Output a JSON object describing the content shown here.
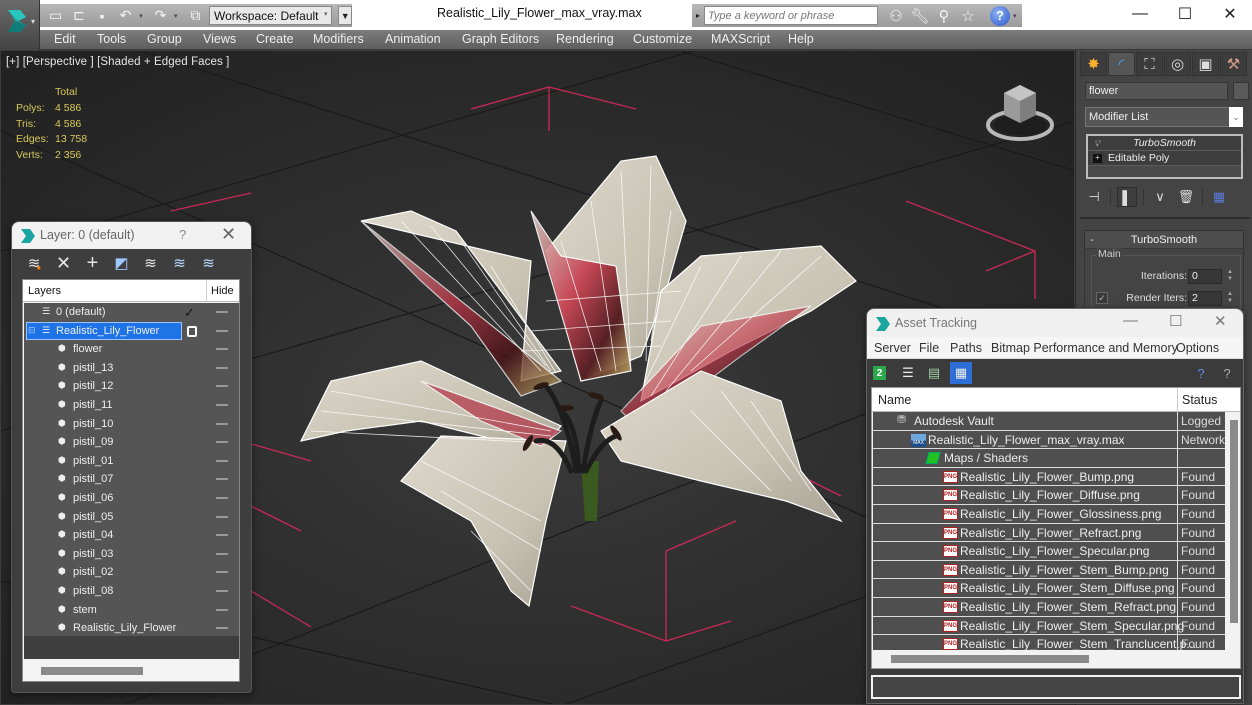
{
  "app": {
    "title": "Realistic_Lily_Flower_max_vray.max",
    "workspace": "Workspace: Default",
    "search_placeholder": "Type a keyword or phrase",
    "window_controls": {
      "minimize": "—",
      "maximize": "☐",
      "close": "✕"
    }
  },
  "quick_access": [
    {
      "icon": "new-file-icon",
      "glyph": "🗋"
    },
    {
      "icon": "open-folder-icon",
      "glyph": "📂"
    },
    {
      "icon": "save-icon",
      "glyph": "💾"
    },
    {
      "icon": "undo-icon",
      "glyph": "↶"
    },
    {
      "icon": "redo-icon",
      "glyph": "↷"
    },
    {
      "icon": "project-folder-icon",
      "glyph": "🗂"
    }
  ],
  "search_tools": [
    {
      "icon": "binoculars-icon",
      "glyph": "🔭"
    },
    {
      "icon": "wrench-icon",
      "glyph": "🔧"
    },
    {
      "icon": "satellite-icon",
      "glyph": "📡"
    },
    {
      "icon": "star-icon",
      "glyph": "☆"
    }
  ],
  "help_glyph": "?",
  "menu": [
    "Edit",
    "Tools",
    "Group",
    "Views",
    "Create",
    "Modifiers",
    "Animation",
    "Graph Editors",
    "Rendering",
    "Customize",
    "MAXScript",
    "Help"
  ],
  "viewport": {
    "label": "[+] [Perspective ] [Shaded + Edged Faces ]",
    "stats": {
      "header": "Total",
      "rows": [
        {
          "label": "Polys:",
          "value": "4 586"
        },
        {
          "label": "Tris:",
          "value": "4 586"
        },
        {
          "label": "Edges:",
          "value": "13 758"
        },
        {
          "label": "Verts:",
          "value": "2 356"
        }
      ]
    }
  },
  "command_panel": {
    "tabs": [
      {
        "name": "create-tab",
        "glyph": "✸"
      },
      {
        "name": "modify-tab",
        "glyph": "◜"
      },
      {
        "name": "hierarchy-tab",
        "glyph": "⛶"
      },
      {
        "name": "motion-tab",
        "glyph": "◎"
      },
      {
        "name": "display-tab",
        "glyph": "▣"
      },
      {
        "name": "utilities-tab",
        "glyph": "⚒"
      }
    ],
    "object_name": "flower",
    "modifier_list": "Modifier List",
    "stack": [
      {
        "label": "TurboSmooth",
        "icon": "lightbulb-icon"
      },
      {
        "label": "Editable Poly",
        "icon": "expand-plus-icon"
      }
    ],
    "rollout": {
      "title": "TurboSmooth",
      "collapse": "-",
      "group": "Main",
      "iterations_label": "Iterations:",
      "iterations": "0",
      "render_iters_label": "Render Iters:",
      "render_iters": "2",
      "render_iters_checked": true
    }
  },
  "layer_dialog": {
    "title": "Layer: 0 (default)",
    "help": "?",
    "close": "✕",
    "columns": {
      "layers": "Layers",
      "hide": "Hide"
    },
    "layers": [
      {
        "name": "0 (default)",
        "type": "layer",
        "current": true
      },
      {
        "name": "Realistic_Lily_Flower",
        "type": "layer",
        "selected": true
      }
    ],
    "objects": [
      "flower",
      "pistil_13",
      "pistil_12",
      "pistil_11",
      "pistil_10",
      "pistil_09",
      "pistil_01",
      "pistil_07",
      "pistil_06",
      "pistil_05",
      "pistil_04",
      "pistil_03",
      "pistil_02",
      "pistil_08",
      "stem",
      "Realistic_Lily_Flower"
    ]
  },
  "asset_tracking": {
    "title": "Asset Tracking",
    "menu": [
      "Server",
      "File",
      "Paths",
      "Bitmap Performance and Memory",
      "Options"
    ],
    "columns": {
      "name": "Name",
      "status": "Status"
    },
    "rows": [
      {
        "name": "Autodesk Vault",
        "status": "Logged",
        "level": 0,
        "icon": "vault"
      },
      {
        "name": "Realistic_Lily_Flower_max_vray.max",
        "status": "Network",
        "level": 1,
        "icon": "max"
      },
      {
        "name": "Maps / Shaders",
        "status": "",
        "level": 2,
        "icon": "maps"
      },
      {
        "name": "Realistic_Lily_Flower_Bump.png",
        "status": "Found",
        "level": 3,
        "icon": "png"
      },
      {
        "name": "Realistic_Lily_Flower_Diffuse.png",
        "status": "Found",
        "level": 3,
        "icon": "png"
      },
      {
        "name": "Realistic_Lily_Flower_Glossiness.png",
        "status": "Found",
        "level": 3,
        "icon": "png"
      },
      {
        "name": "Realistic_Lily_Flower_Refract.png",
        "status": "Found",
        "level": 3,
        "icon": "png"
      },
      {
        "name": "Realistic_Lily_Flower_Specular.png",
        "status": "Found",
        "level": 3,
        "icon": "png"
      },
      {
        "name": "Realistic_Lily_Flower_Stem_Bump.png",
        "status": "Found",
        "level": 3,
        "icon": "png"
      },
      {
        "name": "Realistic_Lily_Flower_Stem_Diffuse.png",
        "status": "Found",
        "level": 3,
        "icon": "png"
      },
      {
        "name": "Realistic_Lily_Flower_Stem_Refract.png",
        "status": "Found",
        "level": 3,
        "icon": "png"
      },
      {
        "name": "Realistic_Lily_Flower_Stem_Specular.png",
        "status": "Found",
        "level": 3,
        "icon": "png"
      },
      {
        "name": "Realistic_Lily_Flower_Stem_Tranclucent.p...",
        "status": "Found",
        "level": 3,
        "icon": "png"
      }
    ]
  },
  "colors": {
    "accent_blue": "#1e73e6",
    "stats_yellow": "#d6c85a",
    "selection_red": "#e0245e"
  }
}
